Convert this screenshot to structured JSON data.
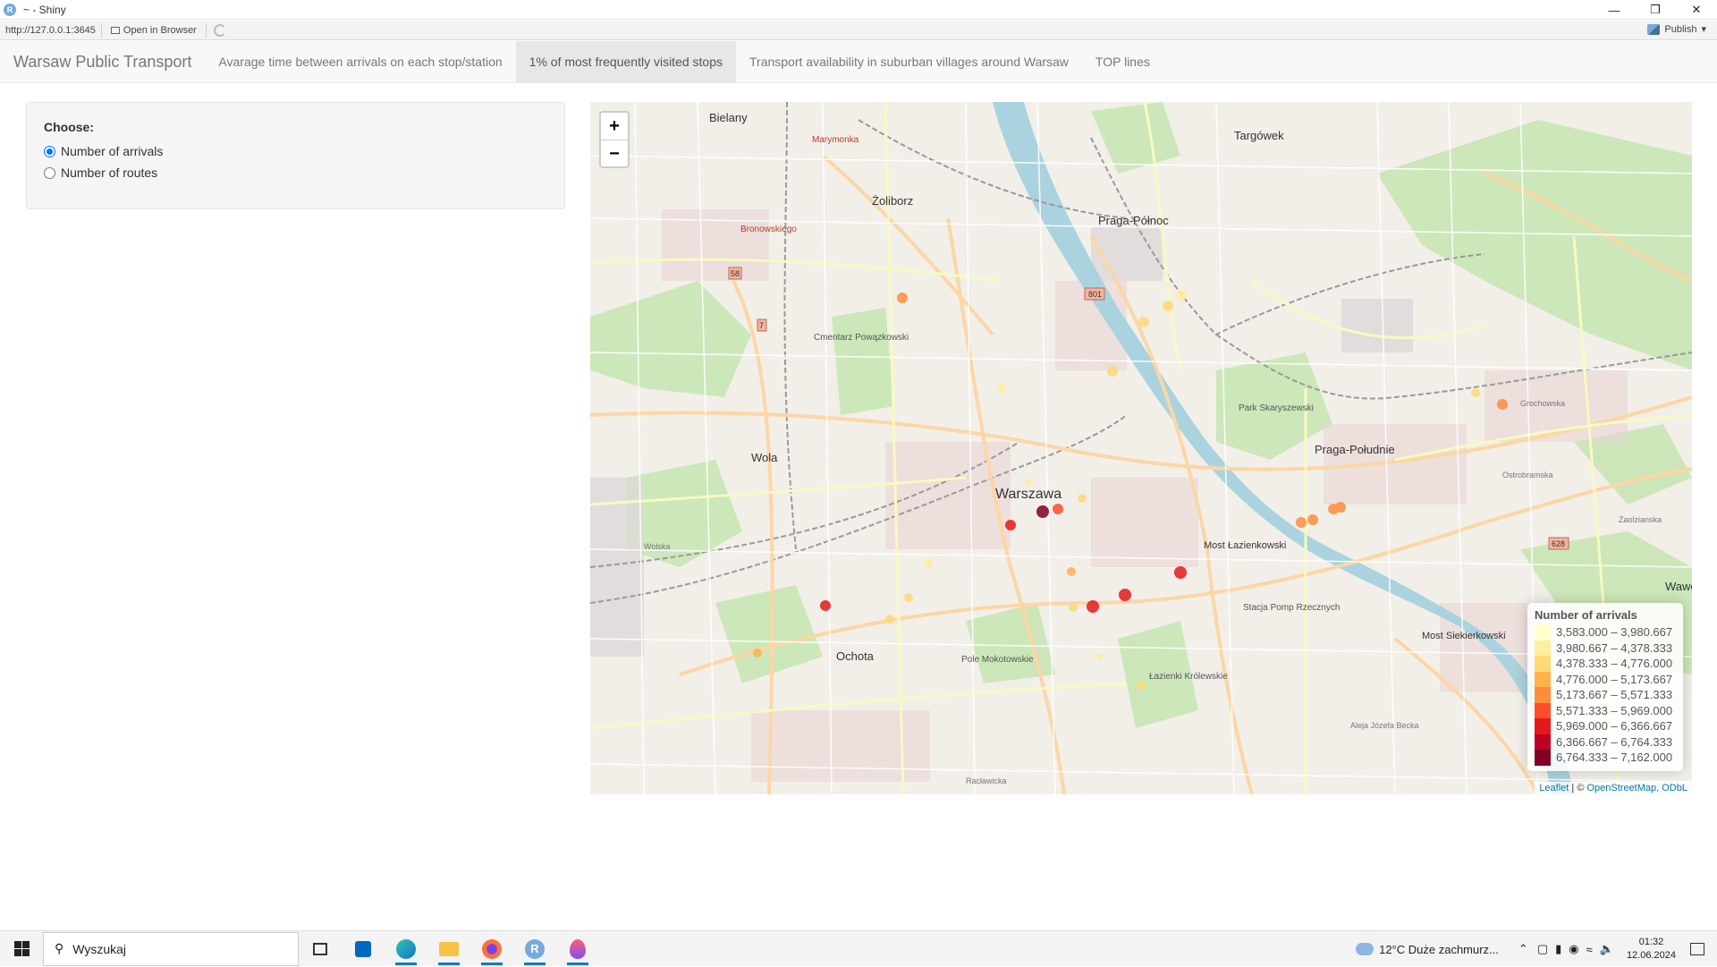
{
  "window": {
    "title": "~ - Shiny",
    "url": "http://127.0.0.1:3645",
    "open_in_browser": "Open in Browser",
    "publish": "Publish"
  },
  "navbar": {
    "brand": "Warsaw Public Transport",
    "tabs": [
      {
        "label": "Avarage time between arrivals on each stop/station",
        "active": false
      },
      {
        "label": "1% of most frequently visited stops",
        "active": true
      },
      {
        "label": "Transport availability in suburban villages around Warsaw",
        "active": false
      },
      {
        "label": "TOP lines",
        "active": false
      }
    ]
  },
  "sidebar": {
    "label": "Choose:",
    "options": [
      {
        "label": "Number of arrivals",
        "selected": true
      },
      {
        "label": "Number of routes",
        "selected": false
      }
    ]
  },
  "map": {
    "zoom_in": "+",
    "zoom_out": "−",
    "place_labels": [
      "Bielany",
      "Targówek",
      "Żoliborz",
      "Praga-Północ",
      "Wola",
      "Warszawa",
      "Praga-Południe",
      "Ochota",
      "Most Łazienkowski",
      "Most Siekierkowski",
      "Cmentarz Powązkowski",
      "Marymonka",
      "Bronowskiego",
      "Park Skaryszewski",
      "Pole Mokotowskie",
      "Łazienki Królewskie",
      "Stacja Pomp Rzecznych",
      "Wawer"
    ],
    "road_labels": [
      "801",
      "58",
      "7",
      "628",
      "Grochowska",
      "Ostrobramska",
      "Aleja Józefa Becka",
      "Racławicka",
      "Wolska",
      "Zaolzianska"
    ],
    "legend": {
      "title": "Number of arrivals",
      "bins": [
        {
          "label": "3,583.000 – 3,980.667",
          "color": "#ffffcc"
        },
        {
          "label": "3,980.667 – 4,378.333",
          "color": "#ffeda0"
        },
        {
          "label": "4,378.333 – 4,776.000",
          "color": "#fed976"
        },
        {
          "label": "4,776.000 – 5,173.667",
          "color": "#feb24c"
        },
        {
          "label": "5,173.667 – 5,571.333",
          "color": "#fd8d3c"
        },
        {
          "label": "5,571.333 – 5,969.000",
          "color": "#fc4e2a"
        },
        {
          "label": "5,969.000 – 6,366.667",
          "color": "#e31a1c"
        },
        {
          "label": "6,366.667 – 6,764.333",
          "color": "#bd0026"
        },
        {
          "label": "6,764.333 – 7,162.000",
          "color": "#800026"
        }
      ]
    },
    "attribution_leaflet": "Leaflet",
    "attribution_sep": " | © ",
    "attribution_osm": "OpenStreetMap, ODbL"
  },
  "taskbar": {
    "search_placeholder": "Wyszukaj",
    "weather": "12°C  Duże zachmurz...",
    "time": "01:32",
    "date": "12.06.2024"
  }
}
